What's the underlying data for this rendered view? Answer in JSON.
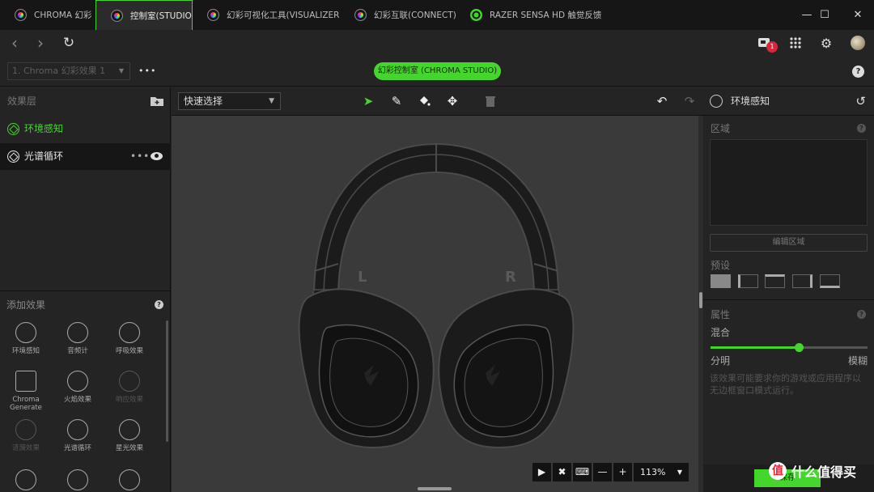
{
  "tabs": [
    {
      "label": "CHROMA 幻彩",
      "icon": "chroma-rainbow-icon"
    },
    {
      "label": "控制室(STUDIO)",
      "icon": "chroma-rainbow-icon",
      "active": true
    },
    {
      "label": "幻彩可视化工具(VISUALIZER",
      "icon": "chroma-rainbow-icon"
    },
    {
      "label": "幻彩互联(CONNECT)",
      "icon": "chroma-rainbow-icon"
    },
    {
      "label": "RAZER SENSA HD 触觉反馈技术",
      "icon": "razer-snake-icon"
    }
  ],
  "window_controls": {
    "minimize": "—",
    "maximize": "☐",
    "close": "✕"
  },
  "nav": {
    "back": "‹",
    "forward": "›",
    "refresh": "↻",
    "notification_count": "1"
  },
  "row3": {
    "preset_value": "1. Chroma 幻彩效果 1",
    "more": "•••",
    "studio_pill": "幻彩控制室 (CHROMA STUDIO)",
    "help": "?"
  },
  "layers": {
    "header": "效果层",
    "items": [
      {
        "label": "环境感知"
      },
      {
        "label": "光谱循环"
      }
    ]
  },
  "add_effects": {
    "title": "添加效果",
    "help": "?",
    "items": [
      {
        "label": "环境感知",
        "icon": "ambient-awareness-icon"
      },
      {
        "label": "音频计",
        "icon": "audio-meter-icon"
      },
      {
        "label": "呼吸效果",
        "icon": "breathing-icon"
      },
      {
        "label": "Chroma Generate",
        "icon": "chroma-generate-icon"
      },
      {
        "label": "火焰效果",
        "icon": "fire-icon"
      },
      {
        "label": "响应效果",
        "icon": "reactive-icon",
        "dim": true
      },
      {
        "label": "涟漪效果",
        "icon": "ripple-icon",
        "dim": true
      },
      {
        "label": "光谱循环",
        "icon": "spectrum-cycling-icon"
      },
      {
        "label": "星光效果",
        "icon": "starlight-icon"
      },
      {
        "label": "",
        "icon": "static-icon"
      },
      {
        "label": "",
        "icon": "wheel-icon"
      },
      {
        "label": "",
        "icon": "wave-icon"
      }
    ]
  },
  "toolbar": {
    "quick_select": "快速选择",
    "select_tool": "select-arrow-icon",
    "pen_tool": "pencil-icon",
    "fill_tool": "paint-bucket-icon",
    "move_tool": "move-arrows-icon",
    "delete_tool": "trash-icon"
  },
  "canvas": {
    "left_label": "L",
    "right_label": "R"
  },
  "zoom_bar": {
    "zoom": "113%"
  },
  "right_panel": {
    "title": "环境感知",
    "zone_label": "区域",
    "edit_zone": "编辑区域",
    "presets_label": "预设",
    "properties_label": "属性",
    "blend_label": "混合",
    "blend_value": 0.56,
    "slider_left": "分明",
    "slider_right": "模糊",
    "note": "该效果可能要求你的游戏或应用程序以无边框窗口模式运行。",
    "save": "保存"
  },
  "colors": {
    "accent": "#44d62c",
    "background": "#242424",
    "canvas": "#3a3a3a"
  },
  "watermark": {
    "text": "什么值得买",
    "icon_text": "值"
  }
}
